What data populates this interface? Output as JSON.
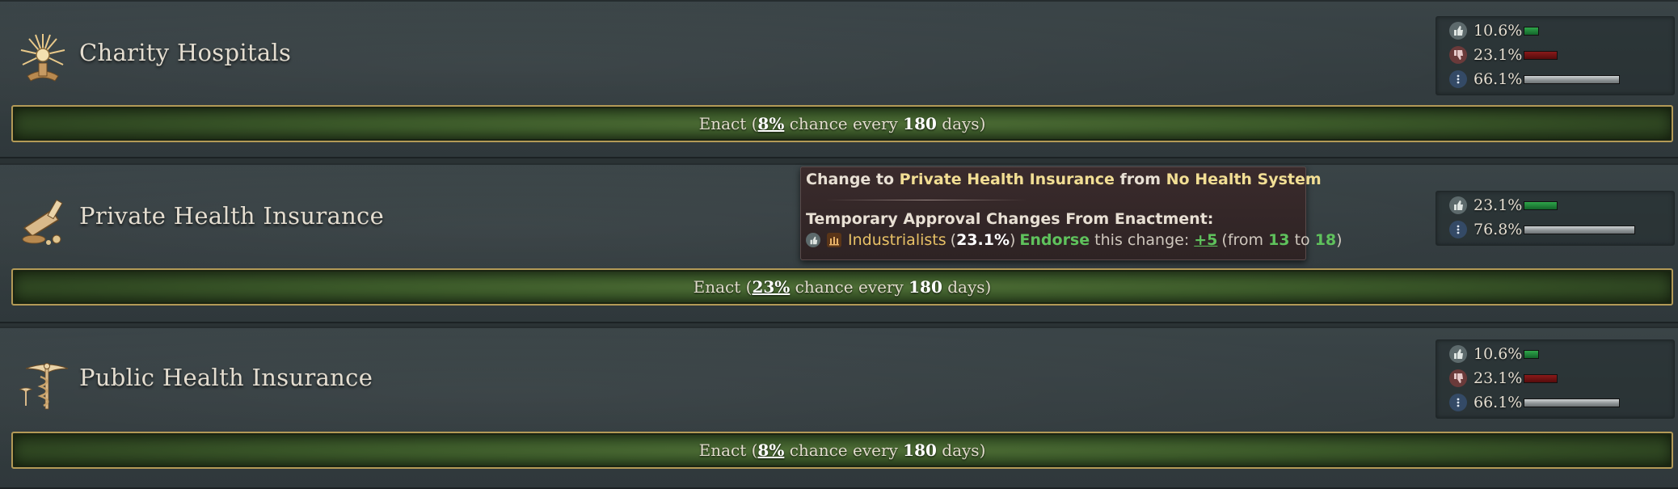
{
  "laws": [
    {
      "title": "Charity Hospitals",
      "icon": "sunburst-icon",
      "enact": {
        "prefix": "Enact (",
        "chance": "8%",
        "middle": " chance every ",
        "days": "180",
        "suffix": " days)"
      },
      "stats": [
        {
          "kind": "approve",
          "value": "10.6%",
          "fraction": 0.106
        },
        {
          "kind": "disapprove",
          "value": "23.1%",
          "fraction": 0.231
        },
        {
          "kind": "neutral",
          "value": "66.1%",
          "fraction": 0.661
        }
      ]
    },
    {
      "title": "Private Health Insurance",
      "icon": "pharmacy-mortar-icon",
      "enact": {
        "prefix": "Enact (",
        "chance": "23%",
        "middle": " chance every ",
        "days": "180",
        "suffix": " days)"
      },
      "stats": [
        {
          "kind": "approve",
          "value": "23.1%",
          "fraction": 0.231
        },
        {
          "kind": "neutral",
          "value": "76.8%",
          "fraction": 0.768
        }
      ]
    },
    {
      "title": "Public Health Insurance",
      "icon": "caduceus-icon",
      "enact": {
        "prefix": "Enact (",
        "chance": "8%",
        "middle": " chance every ",
        "days": "180",
        "suffix": " days)"
      },
      "stats": [
        {
          "kind": "approve",
          "value": "10.6%",
          "fraction": 0.106
        },
        {
          "kind": "disapprove",
          "value": "23.1%",
          "fraction": 0.231
        },
        {
          "kind": "neutral",
          "value": "66.1%",
          "fraction": 0.661
        }
      ]
    }
  ],
  "tooltip": {
    "title_prefix": "Change to ",
    "title_target": "Private Health Insurance",
    "title_mid": " from ",
    "title_source": "No Health System",
    "subtitle": "Temporary Approval Changes From Enactment:",
    "group_name": "Industrialists",
    "group_share": "23.1%",
    "stance": "Endorse",
    "change_text": " this change: ",
    "delta": "+5",
    "from_label": "(from ",
    "from_value": "13",
    "to_label": " to ",
    "to_value": "18",
    "close": ")"
  },
  "colors": {
    "approve_bar": "#1f8a3a",
    "disapprove_bar": "#7a1414",
    "neutral_bar": "#a8adaf",
    "enact_border": "#b39a57",
    "tooltip_gold": "#f2de94",
    "tooltip_green": "#5fc25c"
  }
}
